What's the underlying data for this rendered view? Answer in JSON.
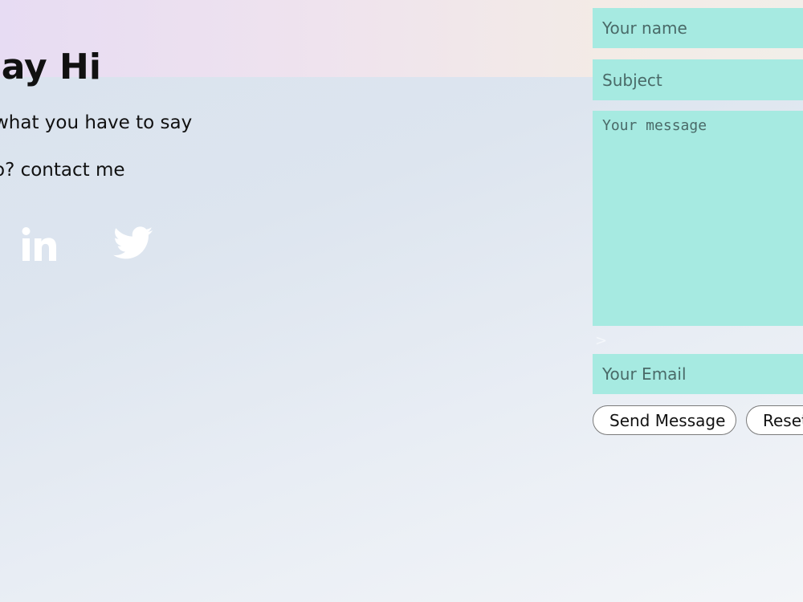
{
  "header": {
    "title": "Say Hi"
  },
  "intro": {
    "line1": "what you have to say",
    "line2": "o? contact me"
  },
  "social": [
    {
      "icon": "linkedin-icon",
      "color": "#ffffff"
    },
    {
      "icon": "twitter-icon",
      "color": "#ffffff"
    }
  ],
  "form": {
    "name_placeholder": "Your name",
    "subject_placeholder": "Subject",
    "message_placeholder": "Your message",
    "stray_glyph": ">",
    "email_placeholder": "Your Email",
    "send_label": "Send Message",
    "reset_label": "Reset",
    "field_color": "#a6eae1"
  }
}
